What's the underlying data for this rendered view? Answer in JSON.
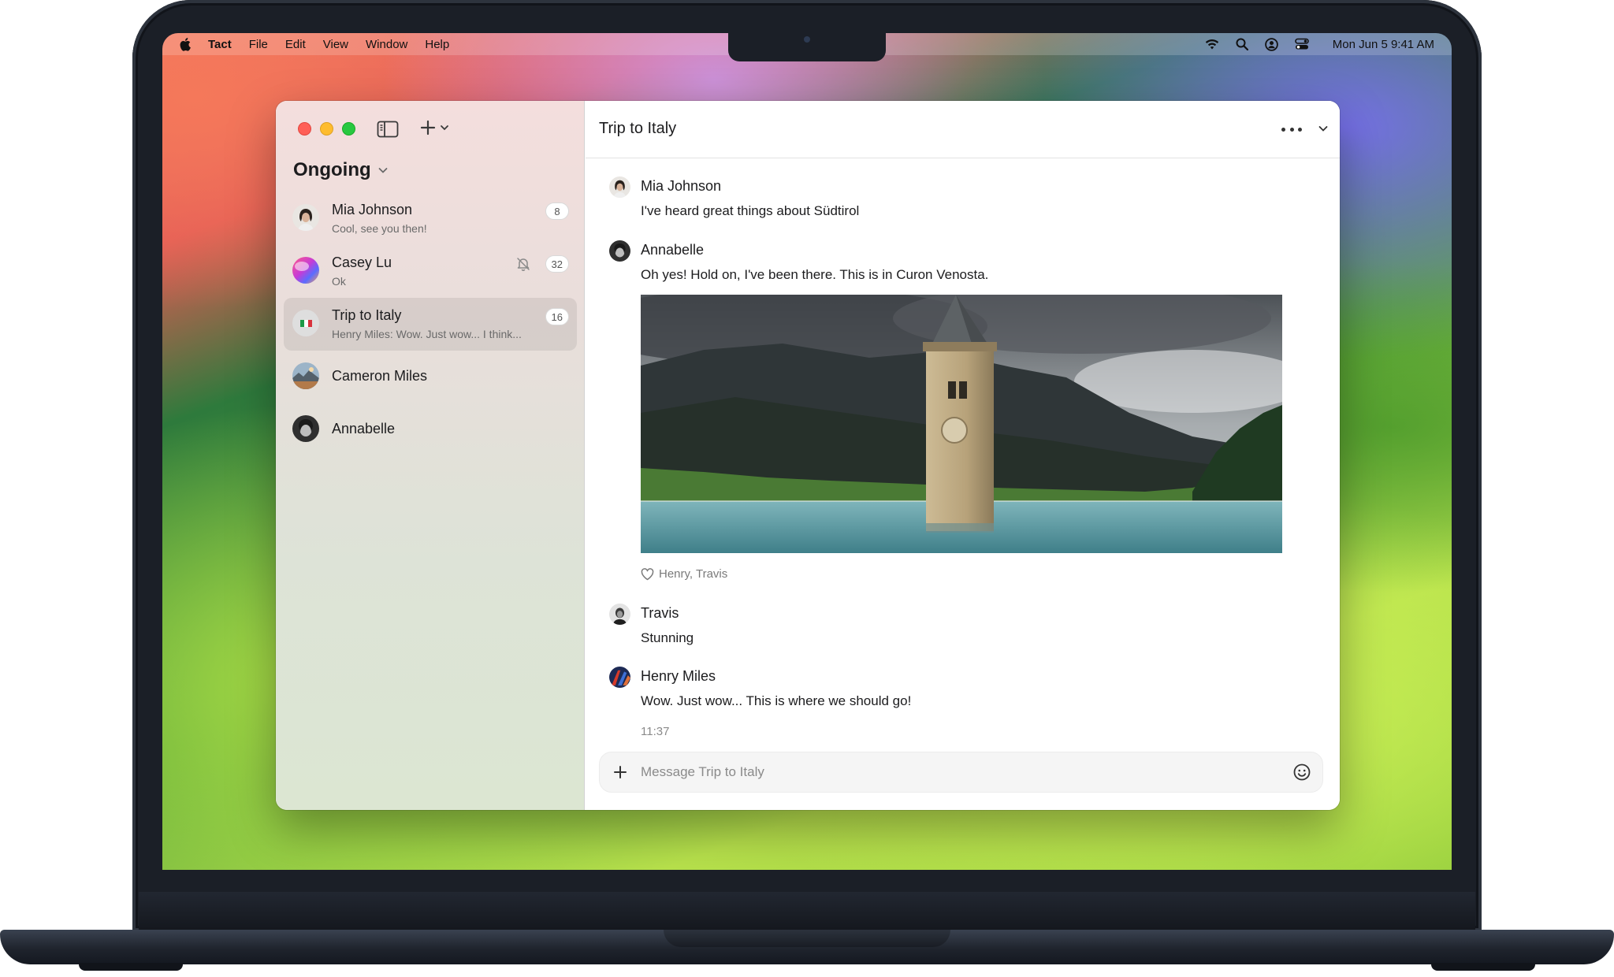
{
  "menubar": {
    "app_name": "Tact",
    "items": [
      "File",
      "Edit",
      "View",
      "Window",
      "Help"
    ],
    "clock": "Mon Jun 5  9:41 AM"
  },
  "sidebar": {
    "section_title": "Ongoing",
    "conversations": [
      {
        "name": "Mia Johnson",
        "preview": "Cool, see you then!",
        "badge": "8"
      },
      {
        "name": "Casey Lu",
        "preview": "Ok",
        "badge": "32",
        "muted": true
      },
      {
        "name": "Trip to Italy",
        "preview": "Henry Miles: Wow. Just wow... I think...",
        "badge": "16",
        "selected": true
      },
      {
        "name": "Cameron Miles"
      },
      {
        "name": "Annabelle"
      }
    ]
  },
  "chat": {
    "title": "Trip to Italy",
    "messages": [
      {
        "author": "Mia Johnson",
        "text": "I've heard great things about Südtirol"
      },
      {
        "author": "Annabelle",
        "text": "Oh yes! Hold on, I've been there. This is in Curon Venosta."
      },
      {
        "author": "Travis",
        "text": "Stunning"
      },
      {
        "author": "Henry Miles",
        "text": "Wow. Just wow... This is where we should go!"
      }
    ],
    "reaction_names": "Henry, Travis",
    "timestamp": "11:37",
    "composer_placeholder": "Message Trip to Italy",
    "composer_value": ""
  },
  "colors": {
    "close": "#ff5f57",
    "minimize": "#febc2e",
    "zoom": "#28c840"
  }
}
